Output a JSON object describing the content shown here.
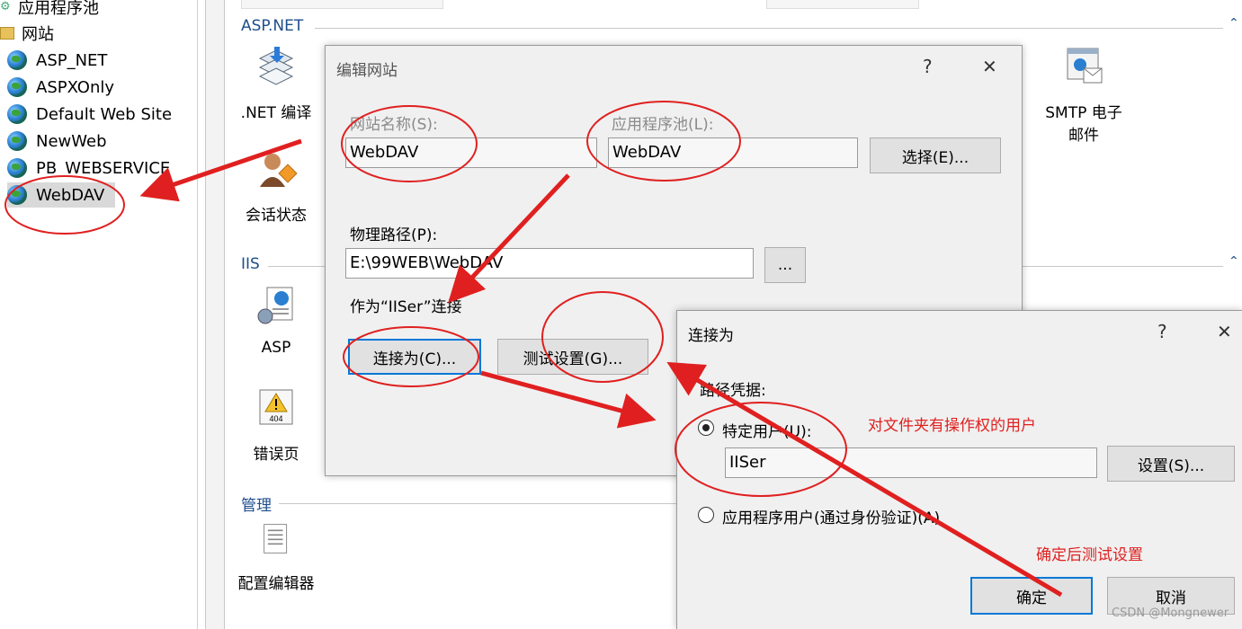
{
  "tree": {
    "app_pools": "应用程序池",
    "sites": "网站",
    "items": [
      "ASP_NET",
      "ASPXOnly",
      "Default Web Site",
      "NewWeb",
      "PB_WEBSERVICE",
      "WebDAV"
    ],
    "selected": "WebDAV"
  },
  "features": {
    "aspnet_group": "ASP.NET",
    "iis_group": "IIS",
    "mgmt_group": "管理",
    "net_compile": ".NET 编译",
    "session_state": "会话状态",
    "smtp_line1": "SMTP 电子",
    "smtp_line2": "邮件",
    "asp": "ASP",
    "error_pages": "错误页",
    "config_editor": "配置编辑器"
  },
  "edit_site": {
    "title": "编辑网站",
    "help": "?",
    "close": "✕",
    "site_name_label": "网站名称(S):",
    "site_name_value": "WebDAV",
    "app_pool_label": "应用程序池(L):",
    "app_pool_value": "WebDAV",
    "select_button": "选择(E)...",
    "physical_path_label": "物理路径(P):",
    "physical_path_value": "E:\\99WEB\\WebDAV",
    "browse_button": "...",
    "connect_as_text": "作为“IISer”连接",
    "connect_as_button": "连接为(C)...",
    "test_settings_button": "测试设置(G)..."
  },
  "connect_as": {
    "title": "连接为",
    "help": "?",
    "close": "✕",
    "path_credentials": "路径凭据:",
    "specific_user": "特定用户(U):",
    "user_value": "IISer",
    "set_button": "设置(S)...",
    "app_user": "应用程序用户(通过身份验证)(A)",
    "ok_button": "确定",
    "cancel_button": "取消"
  },
  "annotations": {
    "note_user": "对文件夹有操作权的用户",
    "note_ok": "确定后测试设置",
    "color": "#e02020"
  },
  "watermark": "CSDN @Mongnewer"
}
